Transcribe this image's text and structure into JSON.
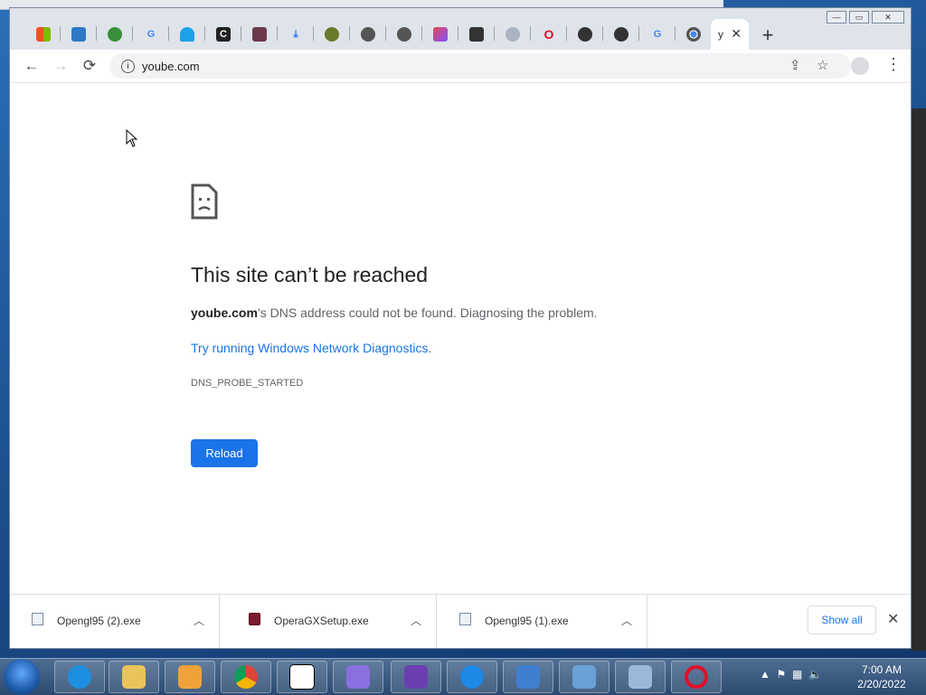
{
  "browser": {
    "tabs": [
      {
        "icon": "windows-icon"
      },
      {
        "icon": "folder-icon"
      },
      {
        "icon": "globe-icon"
      },
      {
        "icon": "google-icon"
      },
      {
        "icon": "pacman-ghost-icon"
      },
      {
        "icon": "cn-icon"
      },
      {
        "icon": "avatar-icon"
      },
      {
        "icon": "download-icon"
      },
      {
        "icon": "globe-icon"
      },
      {
        "icon": "globe-icon"
      },
      {
        "icon": "globe-icon"
      },
      {
        "icon": "kotlin-icon"
      },
      {
        "icon": "archive-icon"
      },
      {
        "icon": "cloud-icon"
      },
      {
        "icon": "opera-icon"
      },
      {
        "icon": "github-icon"
      },
      {
        "icon": "github-icon"
      },
      {
        "icon": "google-icon"
      },
      {
        "icon": "chrome-icon"
      }
    ],
    "active_tab": {
      "title": "y"
    },
    "new_tab_label": "+",
    "url": "yoube.com"
  },
  "error": {
    "title": "This site can’t be reached",
    "domain": "yoube.com",
    "description": "’s DNS address could not be found. Diagnosing the problem.",
    "link_text": "Try running Windows Network Diagnostics",
    "link_suffix": ".",
    "code": "DNS_PROBE_STARTED",
    "reload_label": "Reload"
  },
  "downloads": {
    "items": [
      {
        "name": "Opengl95 (2).exe",
        "icon": "exe-icon"
      },
      {
        "name": "OperaGXSetup.exe",
        "icon": "opera-gx-icon"
      },
      {
        "name": "Opengl95 (1).exe",
        "icon": "exe-icon"
      }
    ],
    "show_all_label": "Show all"
  },
  "taskbar": {
    "apps": [
      "internet-explorer-icon",
      "file-explorer-icon",
      "media-player-icon",
      "chrome-icon",
      "7zip-icon",
      "app-icon",
      "app-icon",
      "edge-icon",
      "network-icon",
      "control-panel-icon",
      "keyboard-icon",
      "opera-icon"
    ],
    "time": "7:00 AM",
    "date": "2/20/2022"
  },
  "colors": {
    "accent": "#1a73e8",
    "title_text": "#202124",
    "body_text": "#5f6368"
  }
}
